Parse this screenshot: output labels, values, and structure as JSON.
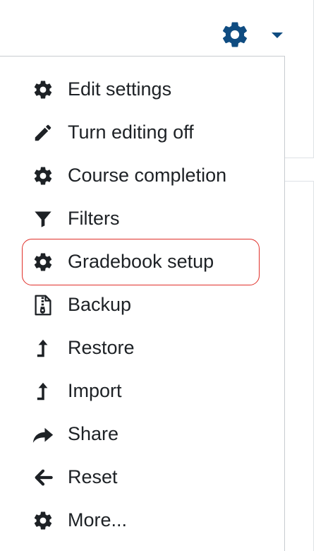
{
  "colors": {
    "gear_trigger": "#0f4c81",
    "menu_icon": "#1d2125",
    "menu_text": "#1d2125",
    "highlight_outline": "#e0302a"
  },
  "trigger": {
    "icon": "gear-icon",
    "caret_icon": "caret-down-icon"
  },
  "menu": {
    "items": [
      {
        "label": "Edit settings",
        "icon": "gear-icon"
      },
      {
        "label": "Turn editing off",
        "icon": "pencil-icon"
      },
      {
        "label": "Course completion",
        "icon": "gear-icon"
      },
      {
        "label": "Filters",
        "icon": "filter-icon"
      },
      {
        "label": "Gradebook setup",
        "icon": "gear-icon",
        "highlighted": true
      },
      {
        "label": "Backup",
        "icon": "file-archive-icon"
      },
      {
        "label": "Restore",
        "icon": "level-up-icon"
      },
      {
        "label": "Import",
        "icon": "level-up-icon"
      },
      {
        "label": "Share",
        "icon": "share-icon"
      },
      {
        "label": "Reset",
        "icon": "arrow-left-icon"
      },
      {
        "label": "More...",
        "icon": "gear-icon"
      }
    ]
  }
}
